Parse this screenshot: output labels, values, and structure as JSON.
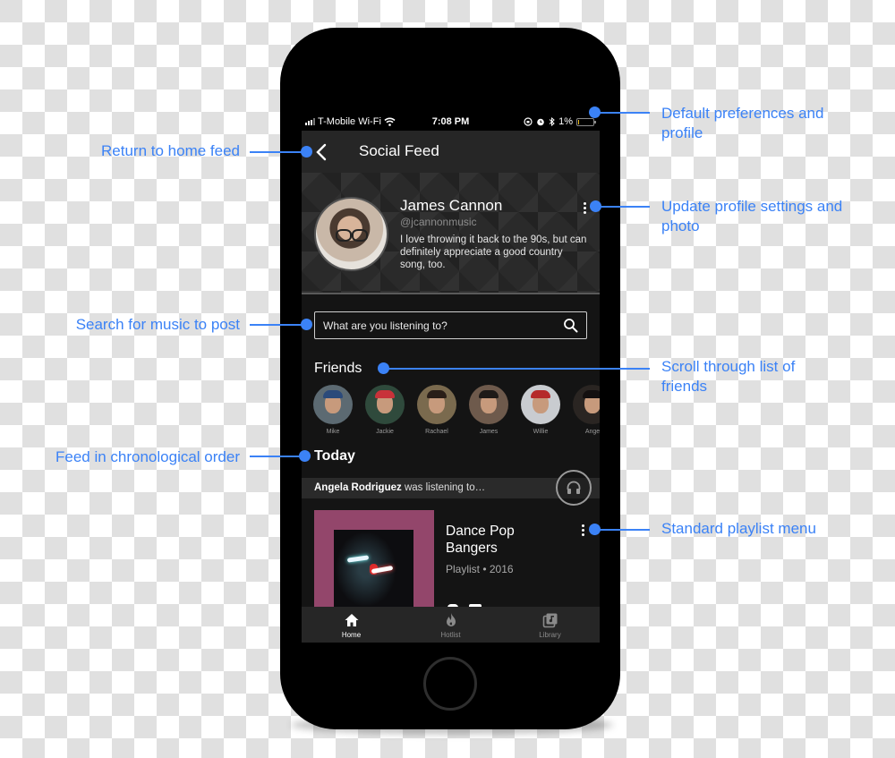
{
  "status_bar": {
    "carrier": "T-Mobile Wi-Fi",
    "time": "7:08 PM",
    "battery": "1%",
    "battery_level_pct": 1
  },
  "nav": {
    "back_icon": "chevron-left-icon",
    "title": "Social Feed"
  },
  "profile": {
    "name": "James Cannon",
    "handle": "@jcannonmusic",
    "bio": "I love throwing it back to the 90s, but can definitely appreciate a good country song, too.",
    "menu_icon": "more-vertical-icon"
  },
  "search": {
    "placeholder": "What are you listening to?",
    "value": "",
    "icon": "search-icon"
  },
  "friends": {
    "title": "Friends",
    "items": [
      {
        "name": "Mike",
        "bg": "#5c6a72",
        "hat": "#2b4a7a"
      },
      {
        "name": "Jackie",
        "bg": "#2f4a3c",
        "hat": "#c8323a"
      },
      {
        "name": "Rachael",
        "bg": "#7a6a4e",
        "hat": "#2a1e18"
      },
      {
        "name": "James",
        "bg": "#6e5a4c",
        "hat": "#1e1a18"
      },
      {
        "name": "Willie",
        "bg": "#c9ccd0",
        "hat": "#b52a2a"
      },
      {
        "name": "Ange",
        "bg": "#2a2522",
        "hat": "#141010"
      }
    ]
  },
  "feed": {
    "section_title": "Today",
    "activity": {
      "user": "Angela Rodriguez",
      "action": " was listening to…",
      "icon": "headphones-icon"
    },
    "playlist": {
      "title": "Dance Pop Bangers",
      "meta": "Playlist • 2016",
      "art_color": "#93466b",
      "menu_icon": "more-vertical-icon"
    }
  },
  "tabbar": {
    "items": [
      {
        "label": "Home",
        "icon": "home-icon",
        "active": true
      },
      {
        "label": "Hotlist",
        "icon": "flame-icon",
        "active": false
      },
      {
        "label": "Library",
        "icon": "library-music-icon",
        "active": false
      }
    ]
  },
  "annotations": {
    "return_home": "Return to home feed",
    "search_music": "Search for music to post",
    "chronological": "Feed in chronological order",
    "default_prefs": "Default preferences and profile",
    "update_profile": "Update profile settings and photo",
    "scroll_friends": "Scroll through list of friends",
    "playlist_menu": "Standard playlist menu"
  },
  "colors": {
    "annotation_blue": "#3b82f6",
    "screen_bg": "#141414",
    "bar_bg": "#262626"
  }
}
